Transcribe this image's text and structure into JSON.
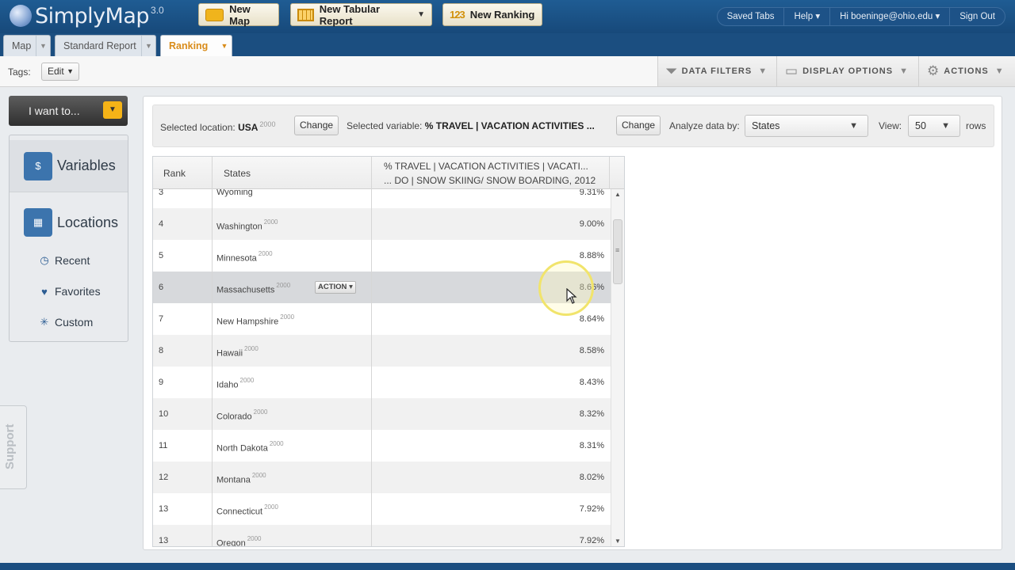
{
  "header": {
    "brand": "SimplyMap",
    "version": "3.0",
    "buttons": {
      "new_map": "New Map",
      "new_tabular_report": "New Tabular Report",
      "new_ranking_icon_text": "123",
      "new_ranking": "New Ranking"
    },
    "right_menu": {
      "saved_tabs": "Saved Tabs",
      "help": "Help ▾",
      "user": "Hi boeninge@ohio.edu ▾",
      "sign_out": "Sign Out"
    }
  },
  "tabs": [
    {
      "label": "Map"
    },
    {
      "label": "Standard Report"
    },
    {
      "label": "Ranking"
    }
  ],
  "toolbar": {
    "tags_label": "Tags:",
    "edit_label": "Edit",
    "data_filters": "DATA FILTERS",
    "display_options": "DISPLAY OPTIONS",
    "actions": "ACTIONS"
  },
  "sidebar": {
    "i_want_to": "I want to...",
    "variables": "Variables",
    "locations": "Locations",
    "recent": "Recent",
    "favorites": "Favorites",
    "custom": "Custom",
    "support": "Support"
  },
  "selection": {
    "location_label": "Selected location:",
    "location_value": "USA",
    "location_year": "2000",
    "change_label": "Change",
    "variable_label": "Selected variable:",
    "variable_value": "% TRAVEL | VACATION ACTIVITIES ...",
    "analyze_label": "Analyze data by:",
    "analyze_value": "States",
    "view_label": "View:",
    "view_value": "50",
    "rows_label": "rows"
  },
  "table": {
    "headers": {
      "rank": "Rank",
      "states": "States",
      "variable_line1": "% TRAVEL | VACATION ACTIVITIES | VACATI...",
      "variable_line2": "... DO | SNOW SKIING/ SNOW BOARDING, 2012"
    },
    "partial_row": {
      "rank": "3",
      "state": "Wyoming",
      "value": "9.31%"
    },
    "rows": [
      {
        "rank": "4",
        "state": "Washington",
        "year": "2000",
        "value": "9.00%"
      },
      {
        "rank": "5",
        "state": "Minnesota",
        "year": "2000",
        "value": "8.88%"
      },
      {
        "rank": "6",
        "state": "Massachusetts",
        "year": "2000",
        "value": "8.66%"
      },
      {
        "rank": "7",
        "state": "New Hampshire",
        "year": "2000",
        "value": "8.64%"
      },
      {
        "rank": "8",
        "state": "Hawaii",
        "year": "2000",
        "value": "8.58%"
      },
      {
        "rank": "9",
        "state": "Idaho",
        "year": "2000",
        "value": "8.43%"
      },
      {
        "rank": "10",
        "state": "Colorado",
        "year": "2000",
        "value": "8.32%"
      },
      {
        "rank": "11",
        "state": "North Dakota",
        "year": "2000",
        "value": "8.31%"
      },
      {
        "rank": "12",
        "state": "Montana",
        "year": "2000",
        "value": "8.02%"
      },
      {
        "rank": "13",
        "state": "Connecticut",
        "year": "2000",
        "value": "7.92%"
      },
      {
        "rank": "13",
        "state": "Oregon",
        "year": "2000",
        "value": "7.92%"
      }
    ],
    "action_label": "ACTION"
  }
}
